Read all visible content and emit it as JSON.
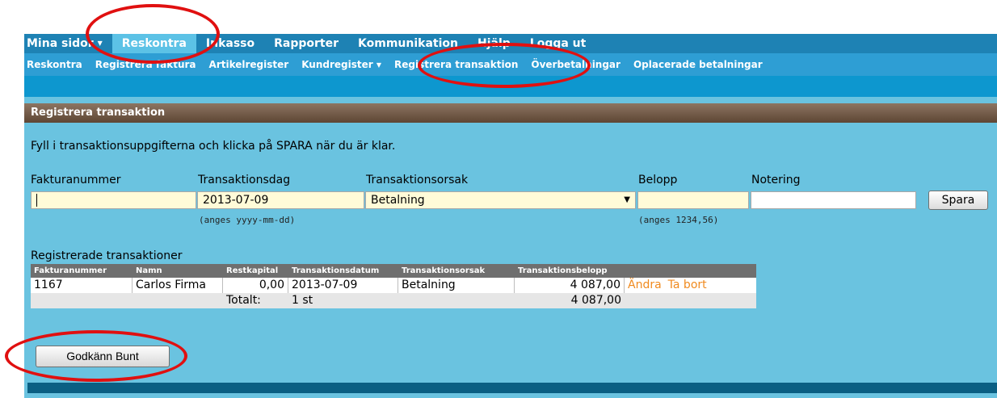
{
  "top_nav": [
    {
      "label": "Mina sidor",
      "has_caret": true,
      "active": false
    },
    {
      "label": "Reskontra",
      "has_caret": false,
      "active": true
    },
    {
      "label": "Inkasso",
      "has_caret": false,
      "active": false
    },
    {
      "label": "Rapporter",
      "has_caret": false,
      "active": false
    },
    {
      "label": "Kommunikation",
      "has_caret": false,
      "active": false
    },
    {
      "label": "Hjälp",
      "has_caret": false,
      "active": false
    },
    {
      "label": "Logga ut",
      "has_caret": false,
      "active": false
    }
  ],
  "sub_nav": [
    {
      "label": "Reskontra",
      "has_caret": false
    },
    {
      "label": "Registrera faktura",
      "has_caret": false
    },
    {
      "label": "Artikelregister",
      "has_caret": false
    },
    {
      "label": "Kundregister",
      "has_caret": true
    },
    {
      "label": "Registrera transaktion",
      "has_caret": false
    },
    {
      "label": "Överbetalningar",
      "has_caret": false
    },
    {
      "label": "Oplacerade betalningar",
      "has_caret": false
    }
  ],
  "panel": {
    "title": "Registrera transaktion",
    "instructions": "Fyll i transaktionsuppgifterna och klicka på SPARA när du är klar."
  },
  "form": {
    "invoice_label": "Fakturanummer",
    "invoice_value": "",
    "date_label": "Transaktionsdag",
    "date_value": "2013-07-09",
    "date_hint": "(anges yyyy-mm-dd)",
    "reason_label": "Transaktionsorsak",
    "reason_value": "Betalning",
    "amount_label": "Belopp",
    "amount_value": "",
    "amount_hint": "(anges 1234,56)",
    "note_label": "Notering",
    "note_value": "",
    "save_label": "Spara"
  },
  "table": {
    "title": "Registrerade transaktioner",
    "headers": [
      "Fakturanummer",
      "Namn",
      "Restkapital",
      "Transaktionsdatum",
      "Transaktionsorsak",
      "Transaktionsbelopp",
      ""
    ],
    "rows": [
      {
        "invoice": "1167",
        "name": "Carlos Firma",
        "remaining": "0,00",
        "date": "2013-07-09",
        "reason": "Betalning",
        "amount": "4 087,00",
        "edit_label": "Ändra",
        "delete_label": "Ta bort"
      }
    ],
    "total": {
      "label": "Totalt:",
      "count": "1 st",
      "amount": "4 087,00"
    }
  },
  "approve_button": "Godkänn Bunt",
  "colors": {
    "top_nav": "#1e82b4",
    "top_nav_active": "#5cc2e6",
    "sub_nav": "#2e9ed4",
    "panel": "#6ac3e0",
    "panel_header": "#6e5644",
    "action_link": "#f08a1e",
    "annotation_ring": "#e01010"
  }
}
